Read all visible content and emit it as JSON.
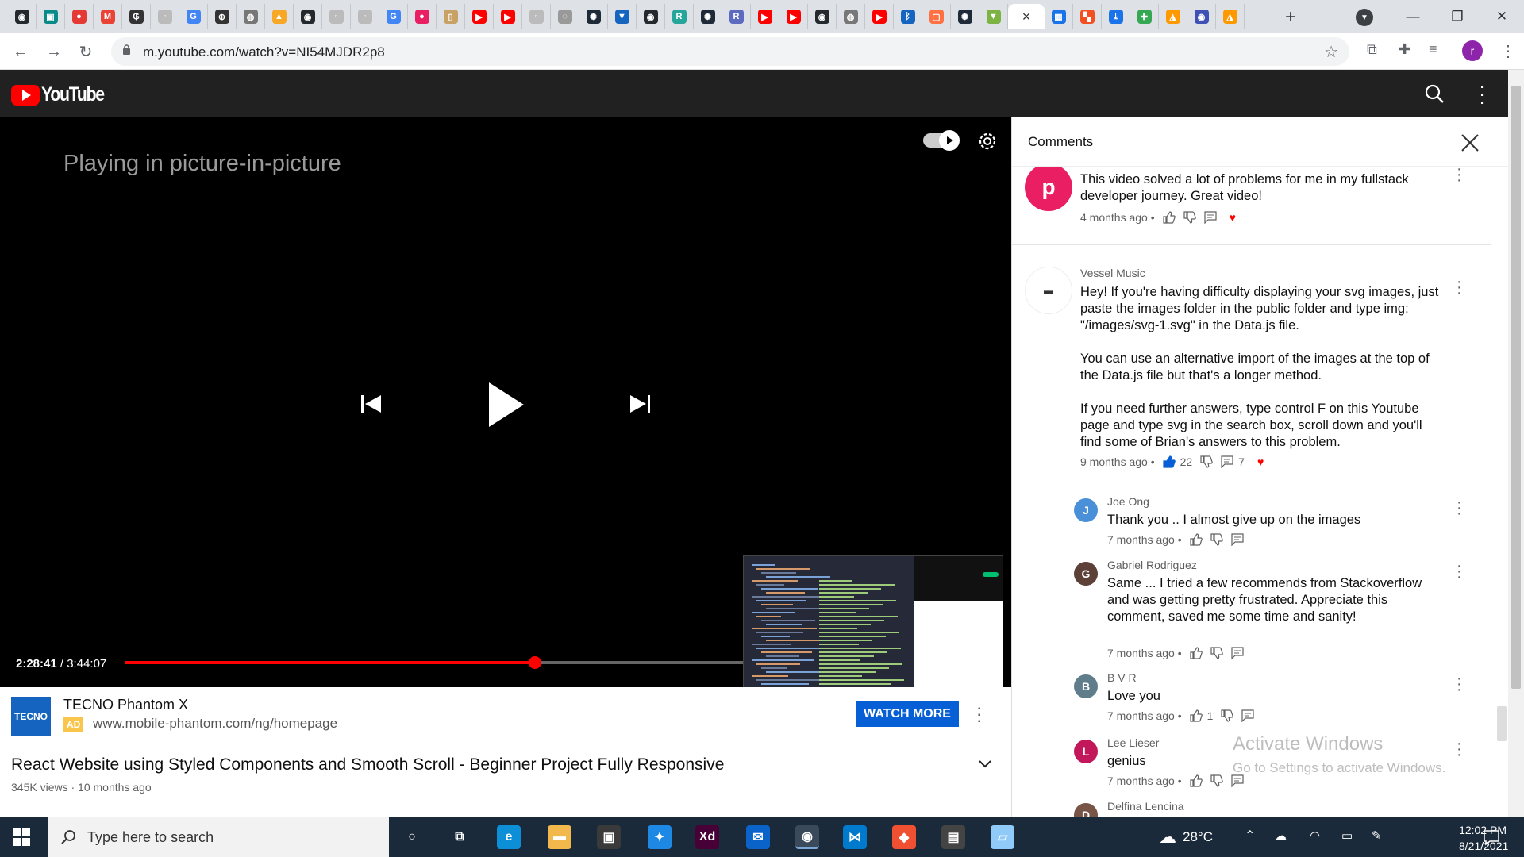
{
  "browser": {
    "tabs": [
      {
        "icon": "github-icon",
        "color": "#24292e",
        "glyph": "◉"
      },
      {
        "icon": "app-tab-icon",
        "color": "#0b8a8a",
        "glyph": "▣"
      },
      {
        "icon": "record-icon",
        "color": "#e53935",
        "glyph": "●"
      },
      {
        "icon": "gmail-icon",
        "color": "#ea4335",
        "glyph": "M"
      },
      {
        "icon": "currency-icon",
        "color": "#333333",
        "glyph": "₲"
      },
      {
        "icon": "blank-page-icon",
        "color": "#bbbbbb",
        "glyph": "▫"
      },
      {
        "icon": "google-icon",
        "color": "#4285f4",
        "glyph": "G"
      },
      {
        "icon": "zoom-icon",
        "color": "#333333",
        "glyph": "⊕"
      },
      {
        "icon": "globe-icon",
        "color": "#777777",
        "glyph": "◍"
      },
      {
        "icon": "flame-icon",
        "color": "#f9a825",
        "glyph": "▲"
      },
      {
        "icon": "github-icon",
        "color": "#24292e",
        "glyph": "◉"
      },
      {
        "icon": "blank-page-icon",
        "color": "#bbbbbb",
        "glyph": "▫"
      },
      {
        "icon": "blank-page-icon",
        "color": "#bbbbbb",
        "glyph": "▫"
      },
      {
        "icon": "google-icon",
        "color": "#4285f4",
        "glyph": "G"
      },
      {
        "icon": "pink-app-icon",
        "color": "#e91e63",
        "glyph": "●"
      },
      {
        "icon": "cup-icon",
        "color": "#c8a165",
        "glyph": "▯"
      },
      {
        "icon": "youtube-icon",
        "color": "#ff0000",
        "glyph": "▶"
      },
      {
        "icon": "youtube-icon",
        "color": "#ff0000",
        "glyph": "▶"
      },
      {
        "icon": "blank-page-icon",
        "color": "#bbbbbb",
        "glyph": "▫"
      },
      {
        "icon": "globe-icon",
        "color": "#999999",
        "glyph": "◌"
      },
      {
        "icon": "react-icon",
        "color": "#1e2a38",
        "glyph": "✺"
      },
      {
        "icon": "triangle-logo-icon",
        "color": "#1565c0",
        "glyph": "▼"
      },
      {
        "icon": "github-icon",
        "color": "#24292e",
        "glyph": "◉"
      },
      {
        "icon": "r-app-icon",
        "color": "#26a69a",
        "glyph": "R"
      },
      {
        "icon": "react-icon",
        "color": "#1e2a38",
        "glyph": "✺"
      },
      {
        "icon": "r-app-icon",
        "color": "#5c6bc0",
        "glyph": "R"
      },
      {
        "icon": "youtube-icon",
        "color": "#ff0000",
        "glyph": "▶"
      },
      {
        "icon": "youtube-icon",
        "color": "#ff0000",
        "glyph": "▶"
      },
      {
        "icon": "github-icon",
        "color": "#24292e",
        "glyph": "◉"
      },
      {
        "icon": "globe-icon",
        "color": "#777777",
        "glyph": "◍"
      },
      {
        "icon": "youtube-icon",
        "color": "#ff0000",
        "glyph": "▶"
      },
      {
        "icon": "bluetooth-icon",
        "color": "#1565c0",
        "glyph": "ᛒ"
      },
      {
        "icon": "html-icon",
        "color": "#ff7043",
        "glyph": "▢"
      },
      {
        "icon": "react-icon",
        "color": "#1e2a38",
        "glyph": "✺"
      },
      {
        "icon": "download-arrow-icon",
        "color": "#7cb342",
        "glyph": "▼"
      }
    ],
    "active_tab_close": "×",
    "tabs_after": [
      {
        "icon": "calendar-icon",
        "color": "#1a73e8",
        "glyph": "▦"
      },
      {
        "icon": "windows-store-icon",
        "color": "#f25022",
        "glyph": "▚"
      },
      {
        "icon": "download-icon",
        "color": "#1a73e8",
        "glyph": "⤓"
      },
      {
        "icon": "puzzle-color-icon",
        "color": "#34a853",
        "glyph": "✚"
      },
      {
        "icon": "aws-icon",
        "color": "#ff9900",
        "glyph": "◮"
      },
      {
        "icon": "circle-logo-icon",
        "color": "#3f51b5",
        "glyph": "◉"
      },
      {
        "icon": "aws-icon",
        "color": "#ff9900",
        "glyph": "◮"
      }
    ],
    "new_tab": "+",
    "url": "m.youtube.com/watch?v=NI54MJDR2p8",
    "profile_initial": "r"
  },
  "youtube": {
    "brand": "YouTube",
    "player": {
      "pip_message": "Playing in picture-in-picture",
      "current_time": "2:28:41",
      "separator": " / ",
      "duration": "3:44:07",
      "progress_fraction": 0.6625
    },
    "ad": {
      "logo_text": "TECNO",
      "title": "TECNO Phantom X",
      "badge": "AD",
      "url": "www.mobile-phantom.com/ng/homepage",
      "cta": "WATCH MORE"
    },
    "video": {
      "title": "React Website using Styled Components and Smooth Scroll - Beginner Project Fully Responsive",
      "meta": "345K views · 10 months ago"
    },
    "comments": {
      "header": "Comments",
      "items": [
        {
          "avatar_letter": "p",
          "avatar_color": "#e91e63",
          "author": "",
          "text": "This video solved a lot of problems for me in my fullstack developer journey.  Great video!",
          "time": "4 months ago",
          "likes": "",
          "replies": ""
        },
        {
          "avatar_letter": "",
          "avatar_color": "#ffffff",
          "author": "Vessel Music",
          "text": "Hey! If you're having difficulty displaying your svg images, just paste the images folder in the public folder and type img: \"/images/svg-1.svg\" in the Data.js file.\n\nYou can use an alternative import of the images at the top of the Data.js file but that's a longer method.\n\nIf you need further answers, type control F on this Youtube page and type svg in the search box, scroll down and you'll find some of Brian's answers to this problem.",
          "time": "9 months ago",
          "likes": "22",
          "replies": "7"
        }
      ],
      "replies": [
        {
          "avatar_letter": "J",
          "avatar_color": "#4a90d9",
          "author": "Joe Ong",
          "text": "Thank you .. I almost give up on the images",
          "time": "7 months ago",
          "likes": ""
        },
        {
          "avatar_letter": "G",
          "avatar_color": "#5d4037",
          "author": "Gabriel Rodriguez",
          "text": "Same ... I tried a few recommends from Stackoverflow and was getting pretty frustrated. Appreciate this comment, saved me some time and sanity!",
          "time": "7 months ago",
          "likes": ""
        },
        {
          "avatar_letter": "B",
          "avatar_color": "#607d8b",
          "author": "B V R",
          "text": "Love you",
          "time": "7 months ago",
          "likes": "1"
        },
        {
          "avatar_letter": "L",
          "avatar_color": "#c2185b",
          "author": "Lee Lieser",
          "text": "genius",
          "time": "7 months ago",
          "likes": ""
        },
        {
          "avatar_letter": "D",
          "avatar_color": "#795548",
          "author": "Delfina Lencina",
          "text": "",
          "time": "",
          "likes": ""
        }
      ]
    }
  },
  "watermark": {
    "line1": "Activate Windows",
    "line2": "Go to Settings to activate Windows."
  },
  "taskbar": {
    "search_placeholder": "Type here to search",
    "apps": [
      {
        "icon": "cortana-icon",
        "label": "○",
        "color": "transparent"
      },
      {
        "icon": "task-view-icon",
        "label": "⧉",
        "color": "transparent"
      },
      {
        "icon": "edge-icon",
        "label": "e",
        "color": "#0c8fd6"
      },
      {
        "icon": "file-explorer-icon",
        "label": "▬",
        "color": "#f2b84b"
      },
      {
        "icon": "store-icon",
        "label": "▣",
        "color": "#3a3a3a"
      },
      {
        "icon": "safari-compass-icon",
        "label": "✦",
        "color": "#1e88e5"
      },
      {
        "icon": "adobe-xd-icon",
        "label": "Xd",
        "color": "#470137"
      },
      {
        "icon": "mail-icon",
        "label": "✉",
        "color": "#0a63c9"
      },
      {
        "icon": "chrome-icon",
        "label": "◉",
        "color": "#34a853"
      },
      {
        "icon": "vscode-icon",
        "label": "⋈",
        "color": "#007acc"
      },
      {
        "icon": "git-icon",
        "label": "◆",
        "color": "#f05032"
      },
      {
        "icon": "git-bash-icon",
        "label": "▤",
        "color": "#444444"
      },
      {
        "icon": "notes-icon",
        "label": "▱",
        "color": "#90caf9"
      }
    ],
    "temperature": "28°C",
    "time": "12:02 PM",
    "date": "8/21/2021"
  }
}
